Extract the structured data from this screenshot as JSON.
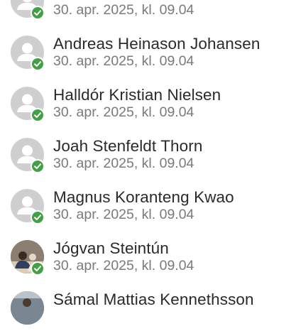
{
  "entries": [
    {
      "name": "",
      "timestamp": "30. apr. 2025, kl. 09.04",
      "avatar": "person-placeholder-icon",
      "status": "check-icon"
    },
    {
      "name": "Andreas Heinason Johansen",
      "timestamp": "30. apr. 2025, kl. 09.04",
      "avatar": "person-placeholder-icon",
      "status": "check-icon"
    },
    {
      "name": "Halldór Kristian Nielsen",
      "timestamp": "30. apr. 2025, kl. 09.04",
      "avatar": "person-placeholder-icon",
      "status": "check-icon"
    },
    {
      "name": "Joah Stenfeldt Thorn",
      "timestamp": "30. apr. 2025, kl. 09.04",
      "avatar": "person-placeholder-icon",
      "status": "check-icon"
    },
    {
      "name": "Magnus Koranteng Kwao",
      "timestamp": "30. apr. 2025, kl. 09.04",
      "avatar": "person-placeholder-icon",
      "status": "check-icon"
    },
    {
      "name": "Jógvan Steintún",
      "timestamp": "30. apr. 2025, kl. 09.04",
      "avatar": "profile-photo",
      "status": "check-icon"
    },
    {
      "name": "Sámal Mattias Kennethsson",
      "timestamp": "",
      "avatar": "profile-photo",
      "status": ""
    }
  ],
  "colors": {
    "status_check": "#43a047",
    "avatar_placeholder": "#cfcfcf",
    "name_text": "#2a2a2a",
    "timestamp_text": "#7a7a7a"
  }
}
